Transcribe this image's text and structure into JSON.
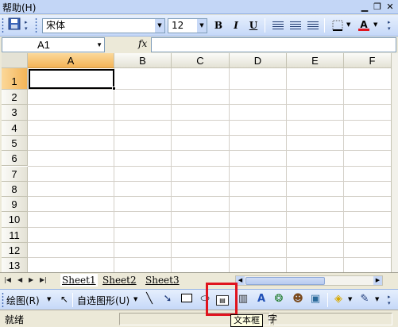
{
  "menu": {
    "help_label": "帮助(H)"
  },
  "format_toolbar": {
    "font_name": "宋体",
    "font_size": "12",
    "bold_label": "B",
    "italic_label": "I",
    "underline_label": "U",
    "font_color_label": "A",
    "font_color": "#e0141e"
  },
  "formula_bar": {
    "name_box": "A1",
    "fx_label": "fx",
    "formula": ""
  },
  "grid": {
    "columns": [
      "A",
      "B",
      "C",
      "D",
      "E",
      "F"
    ],
    "rows": [
      "1",
      "2",
      "3",
      "4",
      "5",
      "6",
      "7",
      "8",
      "9",
      "10",
      "11",
      "12",
      "13"
    ],
    "active_cell": "A1"
  },
  "sheets": {
    "tabs": [
      "Sheet1",
      "Sheet2",
      "Sheet3"
    ],
    "active": "Sheet1"
  },
  "drawing_toolbar": {
    "draw_label": "绘图(R)",
    "autoshapes_label": "自选图形(U)",
    "tooltip": "文本框",
    "tooltip_suffix": "字"
  },
  "status": {
    "text": "就绪"
  }
}
